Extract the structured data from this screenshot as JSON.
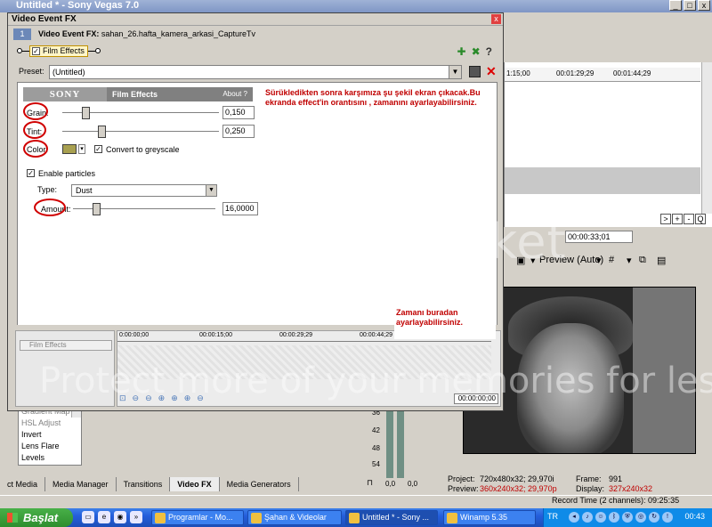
{
  "app": {
    "title": "Untitled * - Sony Vegas 7.0",
    "win_buttons": [
      "_",
      "□",
      "x"
    ]
  },
  "timeline": {
    "ruler_marks": [
      "1:15;00",
      "00:01:29;29",
      "00:01:44;29"
    ],
    "nav_buttons": [
      ">",
      "+",
      "-",
      "Q"
    ],
    "time_readout": "00:00:33;01"
  },
  "preview": {
    "toolbar_label": "Preview (Auto)"
  },
  "props": {
    "project_label": "Project:",
    "project_value": "720x480x32; 29,970i",
    "preview_label": "Preview:",
    "preview_value": "360x240x32; 29,970p",
    "frame_label": "Frame:",
    "frame_value": "991",
    "display_label": "Display:",
    "display_value": "327x240x32",
    "record_time": "Record Time (2 channels): 09:25:35"
  },
  "meter": {
    "labels": [
      "36",
      "42",
      "48",
      "54"
    ],
    "values": [
      "0,0",
      "0,0"
    ]
  },
  "fx_list": {
    "items": [
      "Gradient Map",
      "HSL Adjust",
      "Invert",
      "Lens Flare",
      "Levels"
    ]
  },
  "bottom_tabs": [
    {
      "label": "ct Media"
    },
    {
      "label": "Media Manager"
    },
    {
      "label": "Transitions"
    },
    {
      "label": "Video FX"
    },
    {
      "label": "Media Generators"
    }
  ],
  "dialog": {
    "title": "Video Event FX",
    "close": "x",
    "header_number": "1",
    "header_label": "Video Event FX:",
    "header_file": "sahan_26.hafta_kamera_arkasi_CaptureTv",
    "chain_fx": "Film Effects",
    "preset_label": "Preset:",
    "preset_value": "(Untitled)",
    "panel": {
      "brand": "SONY",
      "name": "Film Effects",
      "about": "About ?",
      "note": "Sürükledikten sonra karşımıza şu şekil ekran çıkacak.Bu ekranda effect'in orantısını , zamanını ayarlayabilirsiniz.",
      "grain_label": "Grain:",
      "grain_value": "0,150",
      "grain_level": 0.15,
      "tint_label": "Tint:",
      "tint_value": "0,250",
      "tint_level": 0.25,
      "color_label": "Color:",
      "color_swatch": "#a8a050",
      "greyscale_label": "Convert to greyscale",
      "particles_label": "Enable particles",
      "type_label": "Type:",
      "type_value": "Dust",
      "amount_label": "Amount:",
      "amount_value": "16,0000",
      "amount_level": 0.16
    },
    "fx_timeline": {
      "left_item": "Film Effects",
      "ruler": [
        "0:00:00;00",
        "00:00:15;00",
        "00:00:29;29",
        "00:00:44;29"
      ],
      "time": "00:00:00;00",
      "note": "Zamanı buradan ayarlayabilirsiniz."
    }
  },
  "taskbar": {
    "start": "Başlat",
    "items": [
      {
        "label": "Programlar - Mo..."
      },
      {
        "label": "Şahan & Videolar"
      },
      {
        "label": "Untitled * - Sony ..."
      },
      {
        "label": "Winamp 5.35"
      }
    ],
    "lang": "TR",
    "clock": "00:43"
  },
  "watermark": {
    "line1": "photobucket",
    "line2": "Protect more of your memories for less!"
  }
}
